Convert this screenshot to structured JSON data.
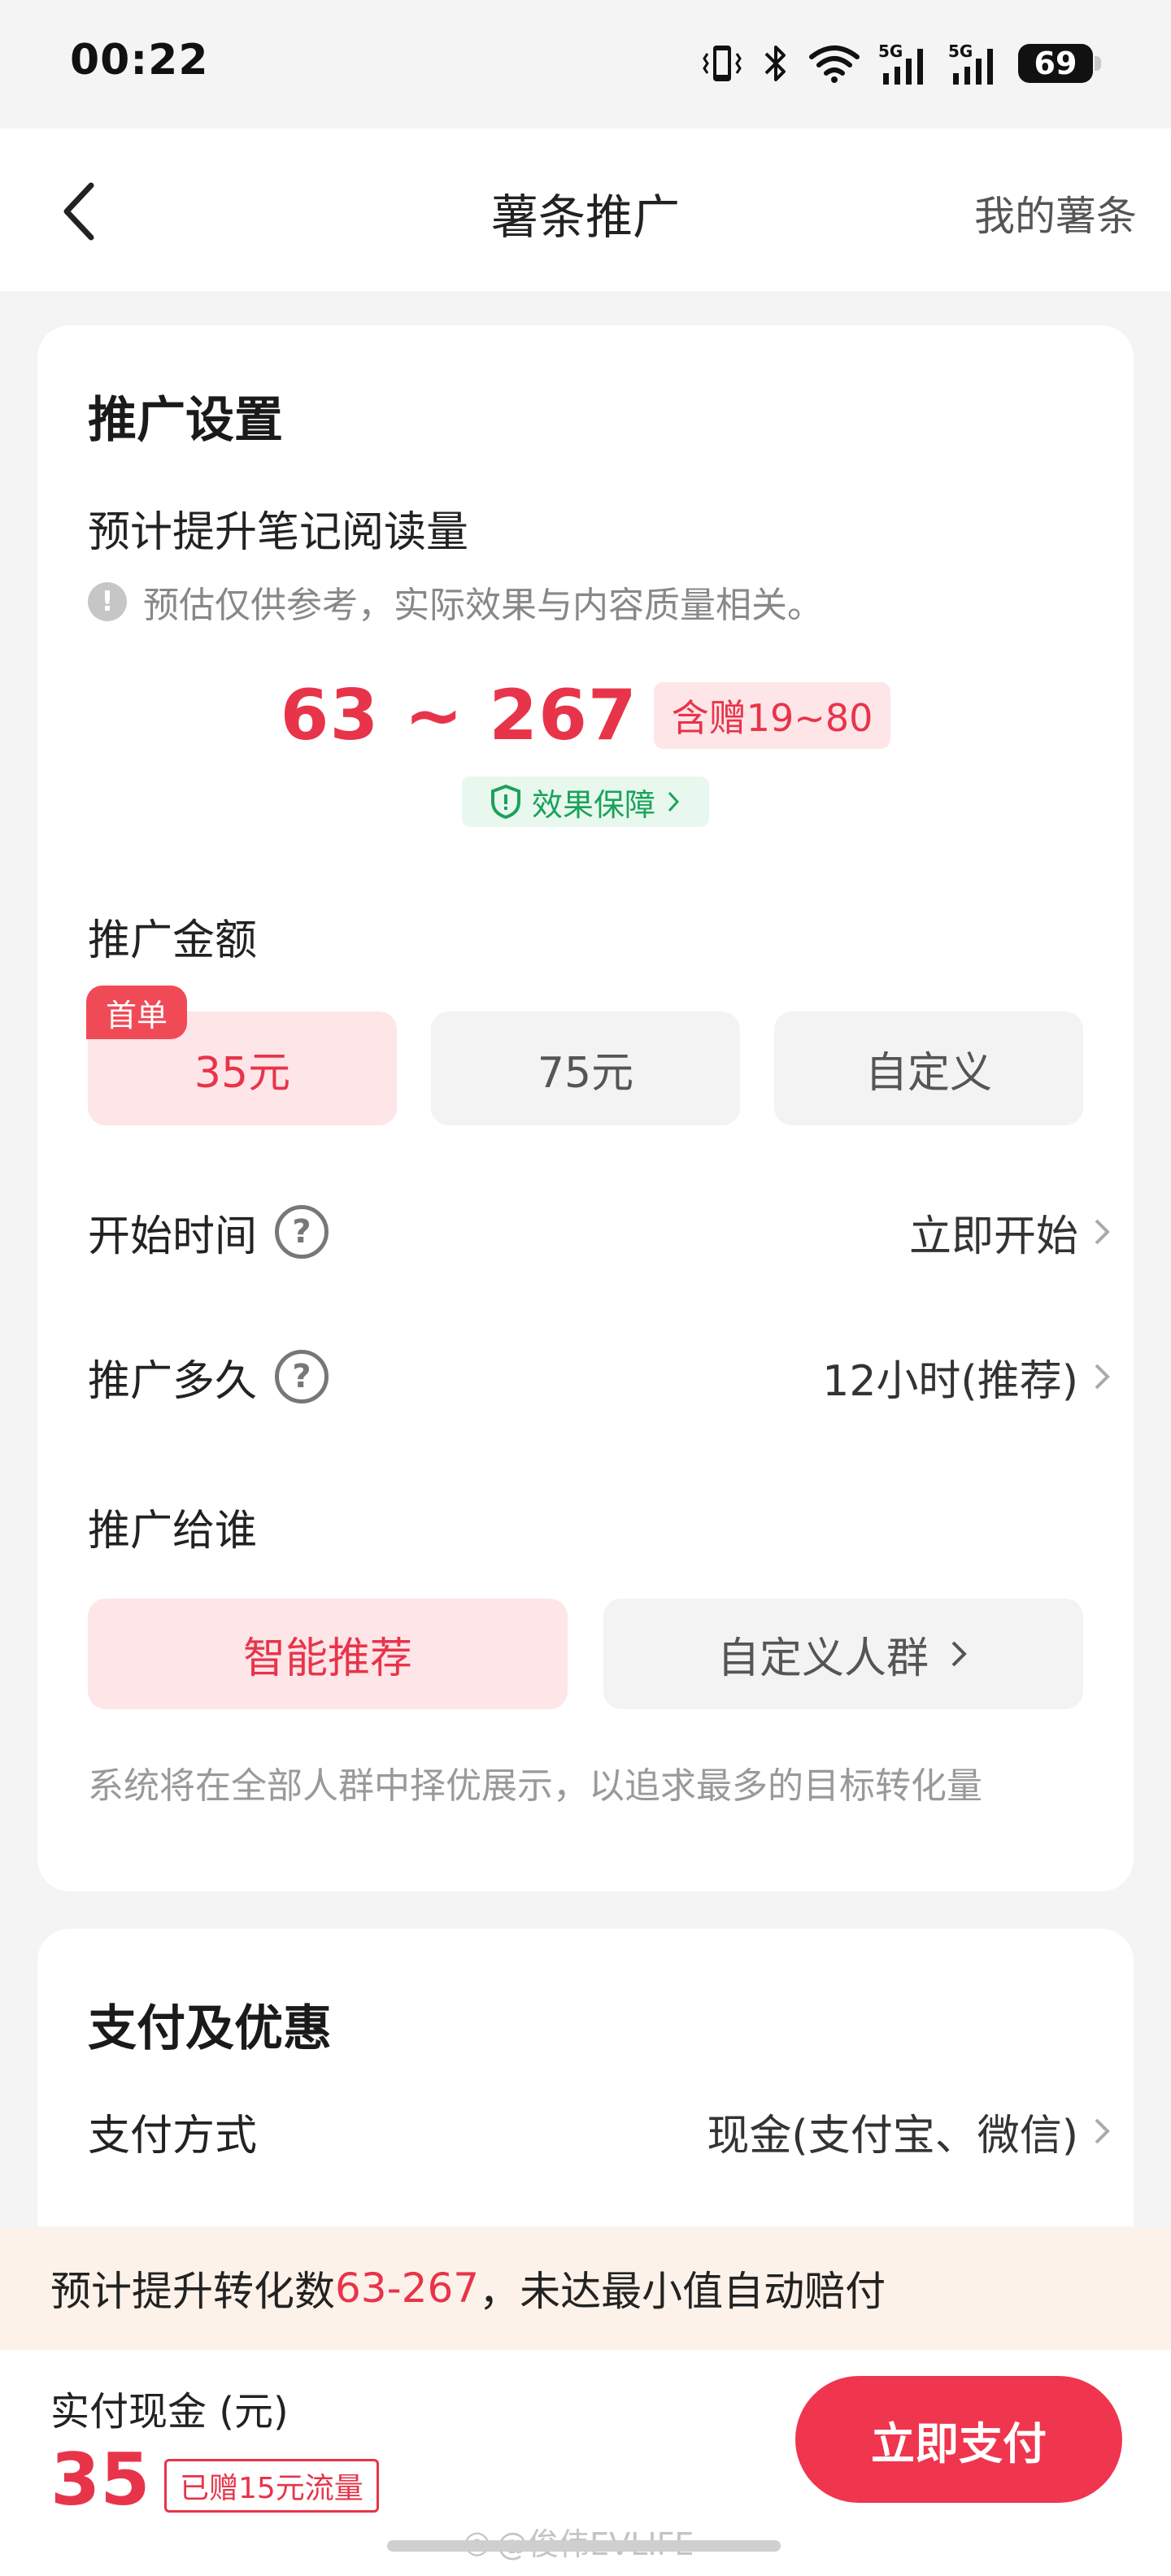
{
  "status_bar": {
    "time": "00:22",
    "battery": "69",
    "network_1": "5G",
    "network_2": "5G",
    "icons": [
      "vibrate-icon",
      "bluetooth-icon",
      "wifi-icon",
      "signal-icon",
      "signal-icon",
      "battery-icon"
    ]
  },
  "nav": {
    "title": "薯条推广",
    "right_link": "我的薯条",
    "back_icon": "chevron-left-icon"
  },
  "settings": {
    "section_title": "推广设置",
    "estimate_label": "预计提升笔记阅读量",
    "estimate_note": "预估仅供参考，实际效果与内容质量相关。",
    "estimate_range": "63 ~ 267",
    "bonus_tag": "含赠19~80",
    "guarantee_label": "效果保障",
    "amount_label": "推广金额",
    "first_badge": "首单",
    "amount_options": [
      {
        "label": "35元",
        "selected": true
      },
      {
        "label": "75元",
        "selected": false
      },
      {
        "label": "自定义",
        "selected": false
      }
    ],
    "start_time": {
      "label": "开始时间",
      "value": "立即开始"
    },
    "duration": {
      "label": "推广多久",
      "value": "12小时(推荐)"
    },
    "audience_label": "推广给谁",
    "audience_options": [
      {
        "label": "智能推荐",
        "selected": true
      },
      {
        "label": "自定义人群",
        "selected": false
      }
    ],
    "audience_desc": "系统将在全部人群中择优展示，以追求最多的目标转化量"
  },
  "payment": {
    "section_title": "支付及优惠",
    "method_label": "支付方式",
    "method_value": "现金(支付宝、微信)"
  },
  "promo_banner": {
    "prefix": "预计提升转化数 ",
    "highlight": "63-267",
    "suffix": "，未达最小值自动赔付"
  },
  "bottom": {
    "pay_label": "实付现金 (元)",
    "amount": "35",
    "gift_tag": "已赠15元流量",
    "pay_button": "立即支付"
  },
  "watermark": "@俊伟EVLIFE",
  "colors": {
    "accent": "#e8344a",
    "accent_bg": "#fde5e8",
    "guarantee_green": "#1aa35a",
    "banner_bg": "#fdf2e9"
  }
}
